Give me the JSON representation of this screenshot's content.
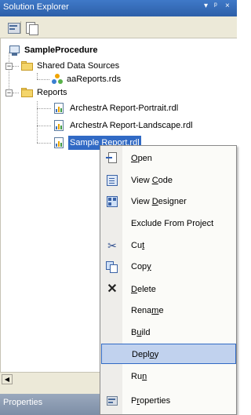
{
  "window": {
    "title": "Solution Explorer",
    "controls": "▾ ᵖ ×"
  },
  "tree": {
    "project": "SampleProcedure",
    "shared_data_sources": "Shared Data Sources",
    "data_source_file": "aaReports.rds",
    "reports_folder": "Reports",
    "report_1": "ArchestrA Report-Portrait.rdl",
    "report_2": "ArchestrA Report-Landscape.rdl",
    "report_3": "Sample Report.rdl"
  },
  "context_menu": {
    "items": [
      {
        "pre": "",
        "acc": "O",
        "post": "pen",
        "icon": "open-icon"
      },
      {
        "pre": "View ",
        "acc": "C",
        "post": "ode",
        "icon": "view-code-icon"
      },
      {
        "pre": "View ",
        "acc": "D",
        "post": "esigner",
        "icon": "view-designer-icon"
      },
      {
        "pre": "Exclude From Project",
        "acc": "",
        "post": "",
        "icon": ""
      },
      {
        "pre": "Cu",
        "acc": "t",
        "post": "",
        "icon": "cut-icon"
      },
      {
        "pre": "Cop",
        "acc": "y",
        "post": "",
        "icon": "copy-icon"
      },
      {
        "pre": "",
        "acc": "D",
        "post": "elete",
        "icon": "delete-icon"
      },
      {
        "pre": "Rena",
        "acc": "m",
        "post": "e",
        "icon": ""
      },
      {
        "pre": "B",
        "acc": "u",
        "post": "ild",
        "icon": ""
      },
      {
        "pre": "Depl",
        "acc": "o",
        "post": "y",
        "icon": ""
      },
      {
        "pre": "Ru",
        "acc": "n",
        "post": "",
        "icon": ""
      },
      {
        "pre": "P",
        "acc": "r",
        "post": "operties",
        "icon": "properties-icon"
      }
    ],
    "highlighted": "Deploy"
  },
  "properties_panel": {
    "title": "Properties"
  }
}
